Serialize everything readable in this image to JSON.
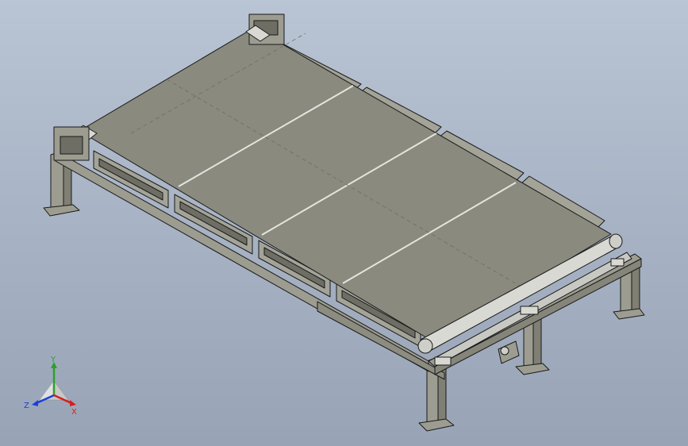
{
  "viewport": {
    "background_top": "#b9c4d4",
    "background_bottom": "#98a4b6"
  },
  "model": {
    "belt_color": "#8a8a7f",
    "frame_color": "#9c9c90",
    "edge_color": "#1a1a1a",
    "roller_color": "#d9d9d4"
  },
  "triad": {
    "x_label": "X",
    "y_label": "Y",
    "z_label": "Z",
    "x_color": "#d81e1e",
    "y_color": "#2ca02c",
    "z_color": "#1f3fd8"
  }
}
